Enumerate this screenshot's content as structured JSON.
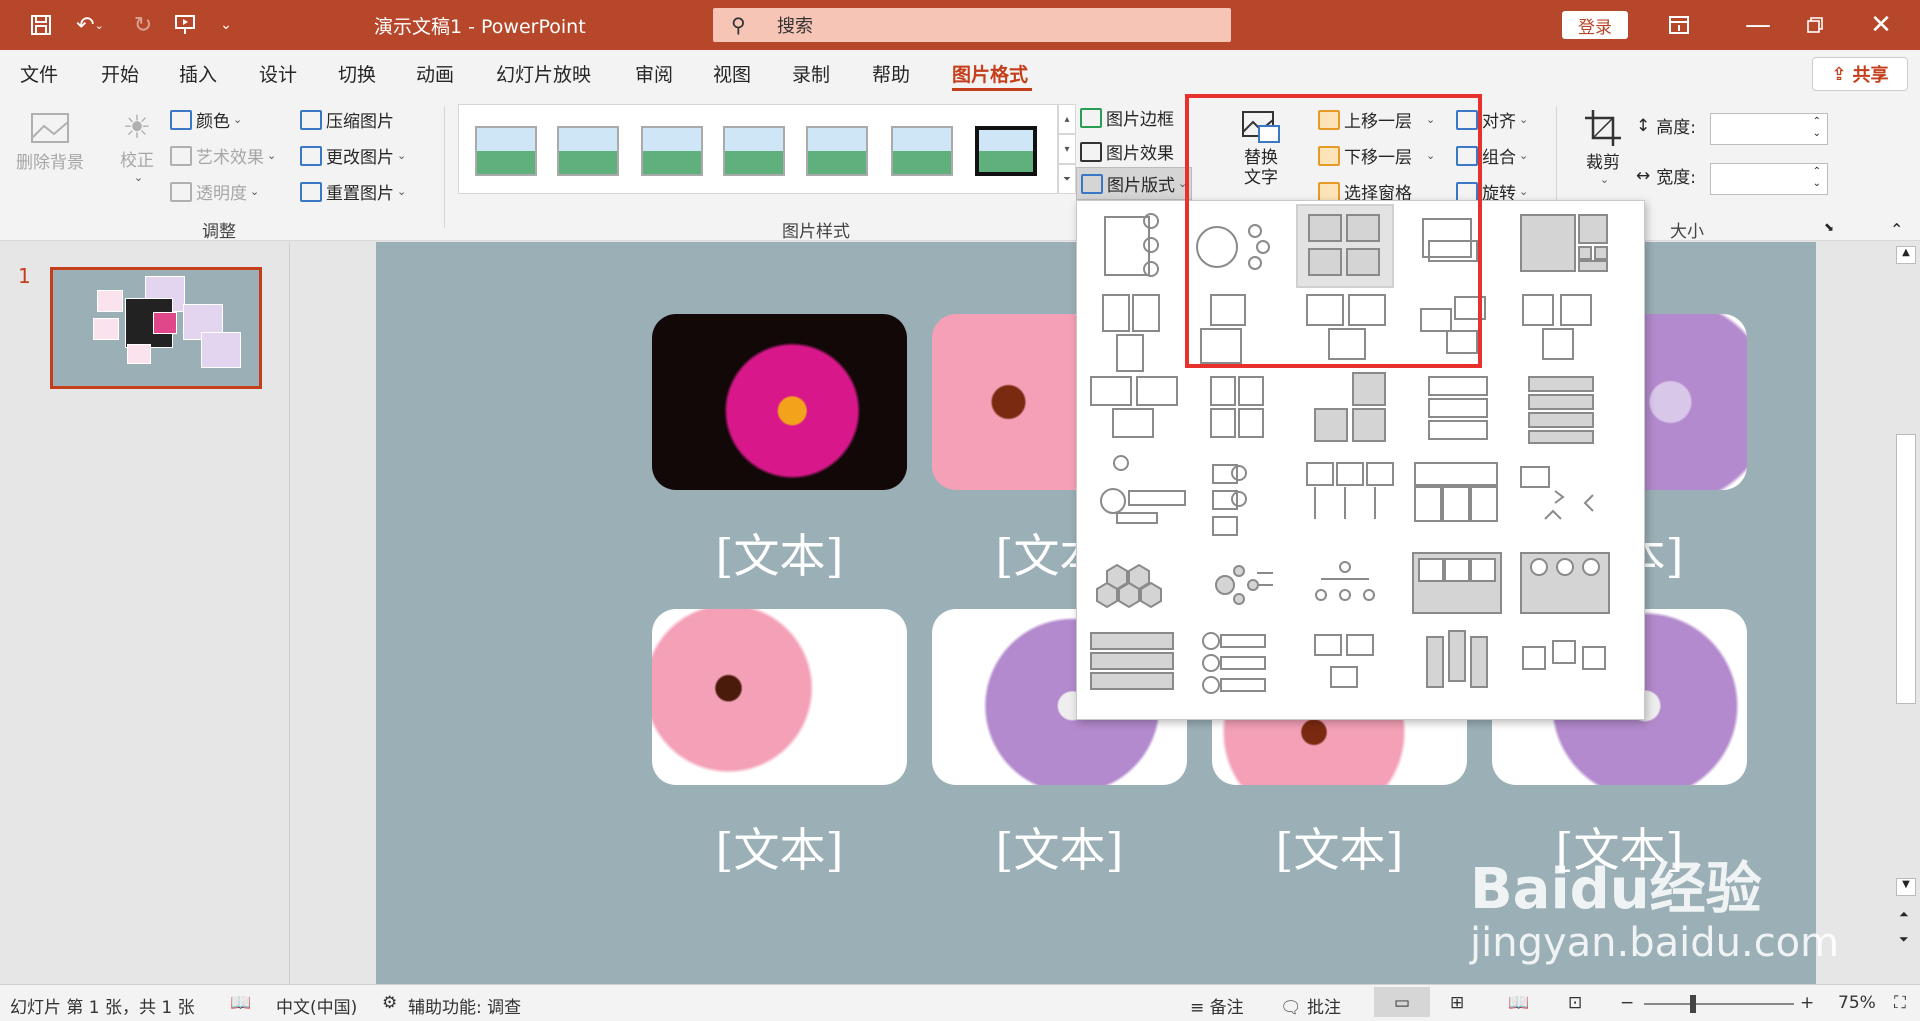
{
  "titlebar": {
    "doc_title": "演示文稿1  -  PowerPoint",
    "search_placeholder": "搜索",
    "login": "登录"
  },
  "tabs": [
    "文件",
    "开始",
    "插入",
    "设计",
    "切换",
    "动画",
    "幻灯片放映",
    "审阅",
    "视图",
    "录制",
    "帮助",
    "图片格式"
  ],
  "share": "共享",
  "ribbon": {
    "remove_bg": "删除背景",
    "correct": "校正",
    "color": "颜色",
    "art_effect": "艺术效果",
    "transparency": "透明度",
    "compress": "压缩图片",
    "change": "更改图片",
    "reset": "重置图片",
    "group_adjust": "调整",
    "group_styles": "图片样式",
    "border": "图片边框",
    "effect": "图片效果",
    "layout": "图片版式",
    "alt_text": "替换\n文字",
    "bring_forward": "上移一层",
    "send_backward": "下移一层",
    "selection_pane": "选择窗格",
    "align": "对齐",
    "group": "组合",
    "rotate": "旋转",
    "crop": "裁剪",
    "height": "高度:",
    "width": "宽度:",
    "group_size": "大小"
  },
  "slide_number": "1",
  "slide": {
    "captions": [
      "[文本]",
      "[文本]",
      "[文本]",
      "[文本]",
      "[文本]",
      "[文本]",
      "[文本]",
      "[文本]"
    ]
  },
  "status": {
    "slide_info": "幻灯片 第 1 张，共 1 张",
    "language": "中文(中国)",
    "accessibility": "辅助功能: 调查",
    "notes": "备注",
    "comments": "批注",
    "zoom": "75%"
  },
  "watermark": {
    "brand": "Baidu经验",
    "url": "jingyan.baidu.com"
  },
  "colors": {
    "accent": "#b7472a",
    "tab_active": "#c43e1c",
    "slide_bg": "#9aafb6",
    "highlight": "#e8302c"
  }
}
